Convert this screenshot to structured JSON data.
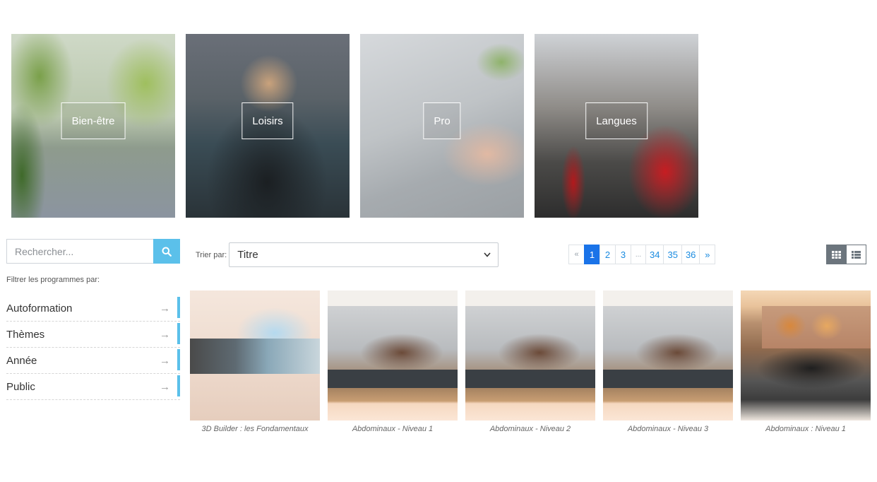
{
  "categories": [
    {
      "label": "Bien-être",
      "icon": "yoga-photo"
    },
    {
      "label": "Loisirs",
      "icon": "camera-photo"
    },
    {
      "label": "Pro",
      "icon": "laptop-photo"
    },
    {
      "label": "Langues",
      "icon": "london-bus-photo"
    }
  ],
  "search": {
    "placeholder": "Rechercher...",
    "value": "",
    "button_icon": "search-icon"
  },
  "filters": {
    "label": "Filtrer les programmes par:",
    "items": [
      {
        "label": "Autoformation"
      },
      {
        "label": "Thèmes"
      },
      {
        "label": "Année"
      },
      {
        "label": "Public"
      }
    ],
    "accent_color": "#5bc0ea"
  },
  "sort": {
    "label": "Trier par:",
    "selected": "Titre"
  },
  "pagination": {
    "prev": "«",
    "pages": [
      "1",
      "2",
      "3"
    ],
    "ellipsis": "...",
    "last_pages": [
      "34",
      "35",
      "36"
    ],
    "next": "»",
    "current": "1",
    "active_color": "#1a73e8"
  },
  "view_toggle": {
    "active": "grid-view",
    "options": [
      "grid-view",
      "list-view"
    ]
  },
  "programs": [
    {
      "title": "3D Builder : les Fondamentaux"
    },
    {
      "title": "Abdominaux - Niveau 1"
    },
    {
      "title": "Abdominaux - Niveau 2"
    },
    {
      "title": "Abdominaux - Niveau 3"
    },
    {
      "title": "Abdominaux : Niveau 1"
    }
  ]
}
